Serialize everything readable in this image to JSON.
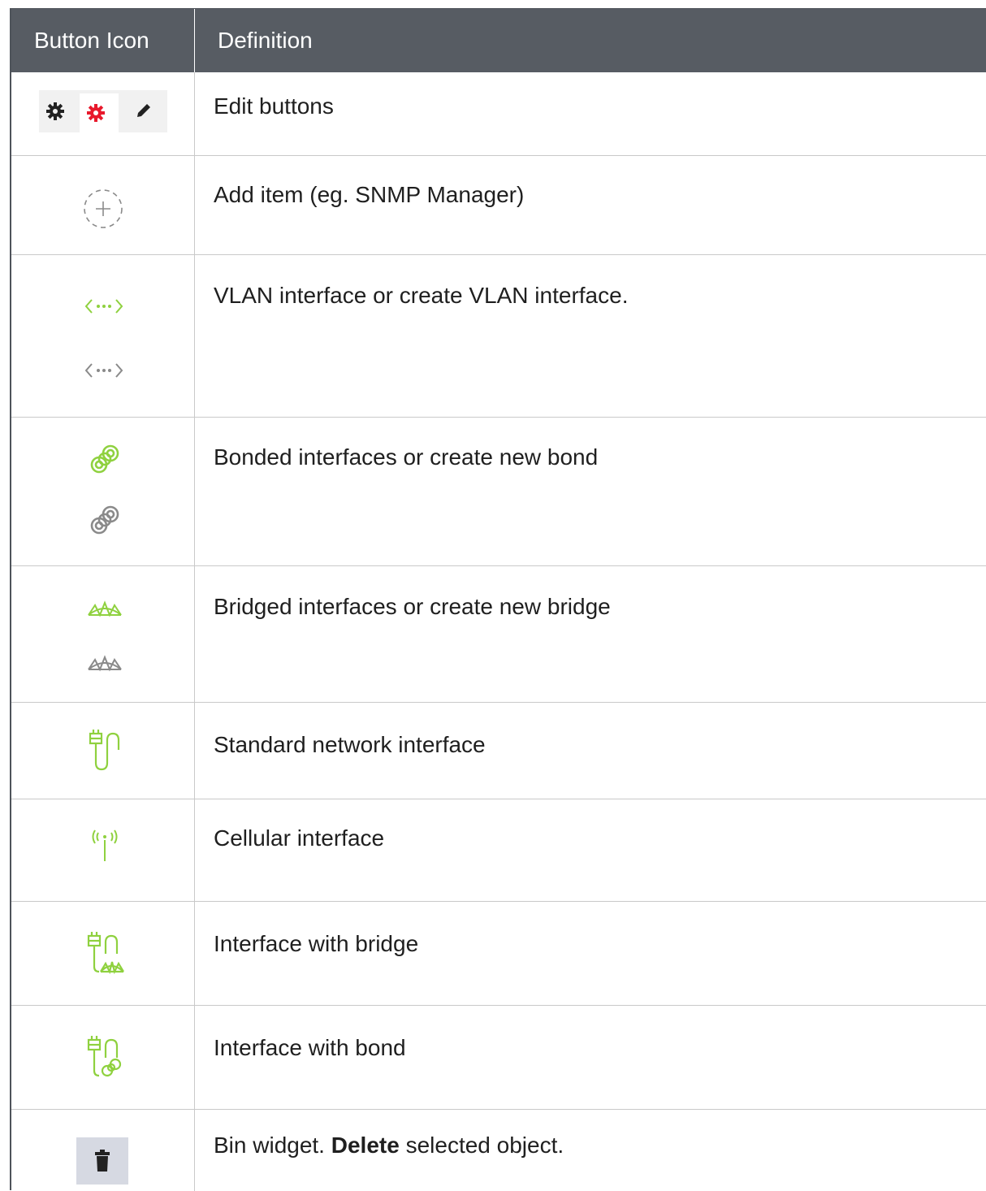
{
  "table": {
    "headers": {
      "icon": "Button Icon",
      "definition": "Definition"
    },
    "rows": [
      {
        "icons": [
          "gear-icon",
          "gear-icon-red",
          "pencil-icon"
        ],
        "definition": "Edit buttons"
      },
      {
        "icons": [
          "add-circle-dashed-icon"
        ],
        "definition": "Add item (eg. SNMP Manager)"
      },
      {
        "icons": [
          "vlan-icon-green",
          "vlan-icon-grey"
        ],
        "definition": "VLAN interface or create VLAN interface."
      },
      {
        "icons": [
          "bond-icon-green",
          "bond-icon-grey"
        ],
        "definition": "Bonded interfaces or create new bond"
      },
      {
        "icons": [
          "bridge-icon-green",
          "bridge-icon-grey"
        ],
        "definition": "Bridged interfaces or create new bridge"
      },
      {
        "icons": [
          "network-interface-icon"
        ],
        "definition": "Standard network interface"
      },
      {
        "icons": [
          "cellular-icon"
        ],
        "definition": "Cellular interface"
      },
      {
        "icons": [
          "interface-bridge-icon"
        ],
        "definition": "Interface with bridge"
      },
      {
        "icons": [
          "interface-bond-icon"
        ],
        "definition": "Interface with bond"
      },
      {
        "icons": [
          "trash-icon"
        ],
        "definition_prefix": "Bin widget. ",
        "definition_bold": "Delete",
        "definition_suffix": " selected object."
      }
    ]
  },
  "colors": {
    "header_bg": "#575c63",
    "accent_green": "#8fd13f",
    "icon_grey": "#8a8a8a",
    "red": "#e8192c"
  }
}
